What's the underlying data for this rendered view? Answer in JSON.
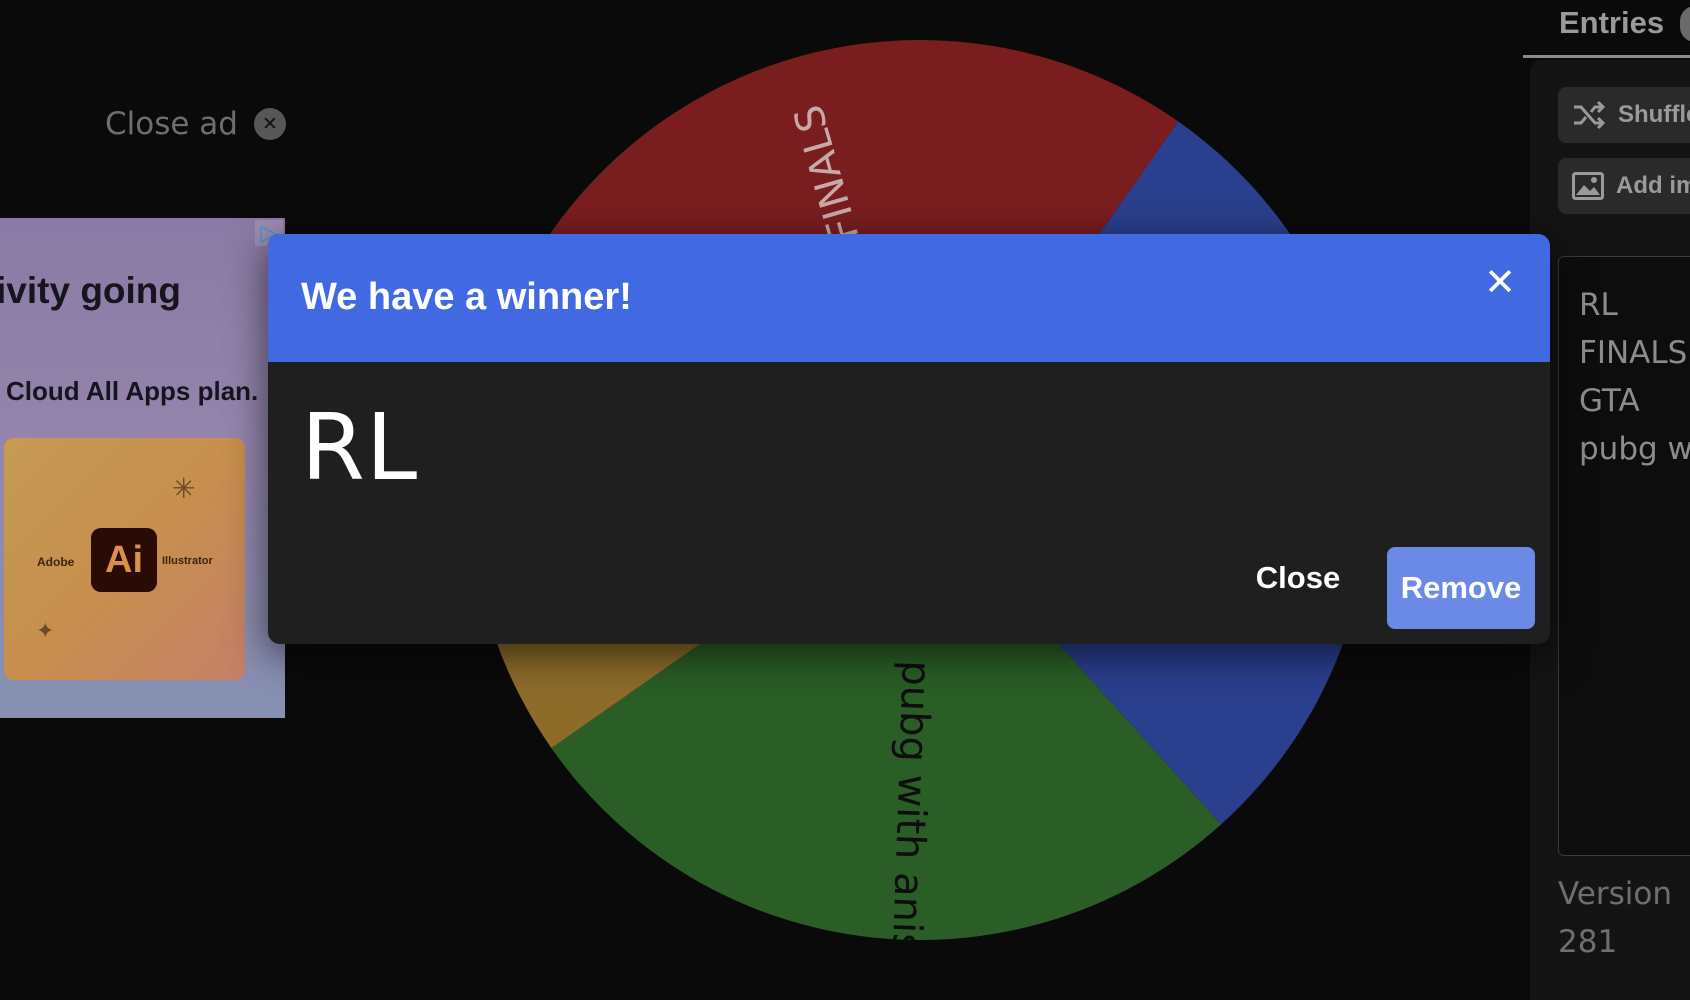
{
  "wheel": {
    "segments": [
      {
        "label": "FINALS",
        "color": "#7a1d1f"
      },
      {
        "label": "RL",
        "color": "#2a3f8e"
      },
      {
        "label": "pubg with anish",
        "color": "#2a5e26"
      },
      {
        "label": "GTA",
        "color": "#8d6c2a"
      }
    ]
  },
  "ad": {
    "close_label": "Close ad",
    "headline": "ivity going",
    "body": "Cloud All Apps plan.",
    "card_left": "Adobe",
    "card_right": "Illustrator",
    "logo": "Ai"
  },
  "sidebar": {
    "tab_label": "Entries",
    "shuffle_label": "Shuffle",
    "add_image_label": "Add image",
    "entries": [
      "RL",
      "FINALS",
      "GTA",
      "pubg with anish"
    ],
    "version_label": "Version",
    "version_number": "281"
  },
  "modal": {
    "title": "We have a winner!",
    "winner": "RL",
    "close_label": "Close",
    "remove_label": "Remove",
    "close_icon": "close-icon"
  },
  "colors": {
    "header_blue": "#4169e1",
    "remove_button": "#6a8ae6",
    "modal_bg": "#1f1f1f"
  }
}
